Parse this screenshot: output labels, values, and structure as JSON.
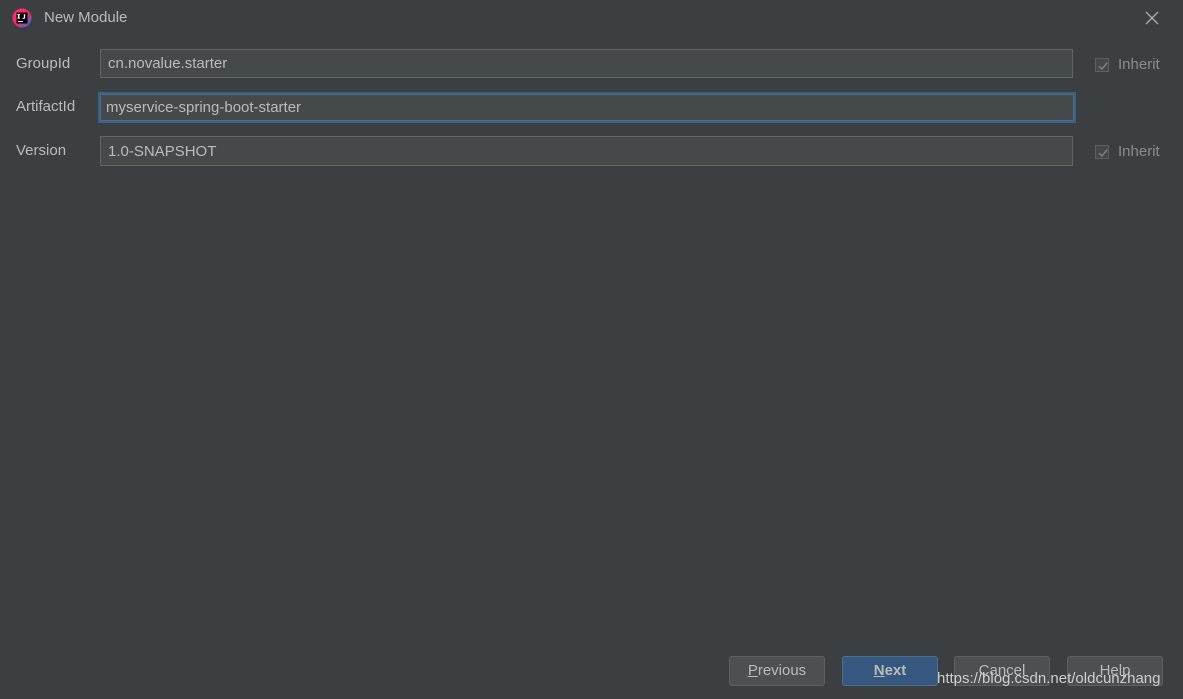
{
  "window": {
    "title": "New Module",
    "app_icon": "intellij-idea-icon",
    "close_icon": "close-icon"
  },
  "form": {
    "group_id": {
      "label": "GroupId",
      "value": "cn.novalue.starter",
      "inherit_label": "Inherit",
      "inherit_checked": true
    },
    "artifact_id": {
      "label": "ArtifactId",
      "value": "myservice-spring-boot-starter"
    },
    "version": {
      "label": "Version",
      "value": "1.0-SNAPSHOT",
      "inherit_label": "Inherit",
      "inherit_checked": true
    }
  },
  "buttons": {
    "previous_mnemonic": "P",
    "previous_rest": "revious",
    "next_mnemonic": "N",
    "next_rest": "ext",
    "cancel_label": "Cancel",
    "help_label": "Help"
  },
  "watermark": "https://blog.csdn.net/oldcunzhang",
  "colors": {
    "background": "#3c3f41",
    "field_background": "#45494a",
    "focus_border": "#3d6185",
    "primary_button": "#365880"
  }
}
